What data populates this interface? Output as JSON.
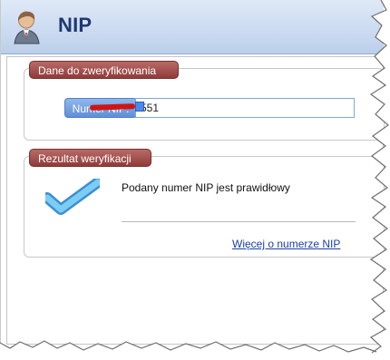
{
  "window": {
    "title": "NIP",
    "icon": "user-icon"
  },
  "verify_section": {
    "label": "Dane do zweryfikowania",
    "nip_field": {
      "label": "Numer NIP:",
      "value": "551"
    }
  },
  "result_section": {
    "label": "Rezultat weryfikacji",
    "status_icon": "check-icon",
    "message": "Podany numer NIP jest prawidłowy",
    "more_link": "Więcej o numerze NIP"
  },
  "colors": {
    "header_bg": "#c9d9f0",
    "header_text": "#1f3970",
    "section_label_bg": "#8f3c3a",
    "field_label_bg": "#5f8fd8",
    "check_color": "#64b8ea",
    "link_color": "#1b40a8",
    "redaction": "#d01414"
  }
}
